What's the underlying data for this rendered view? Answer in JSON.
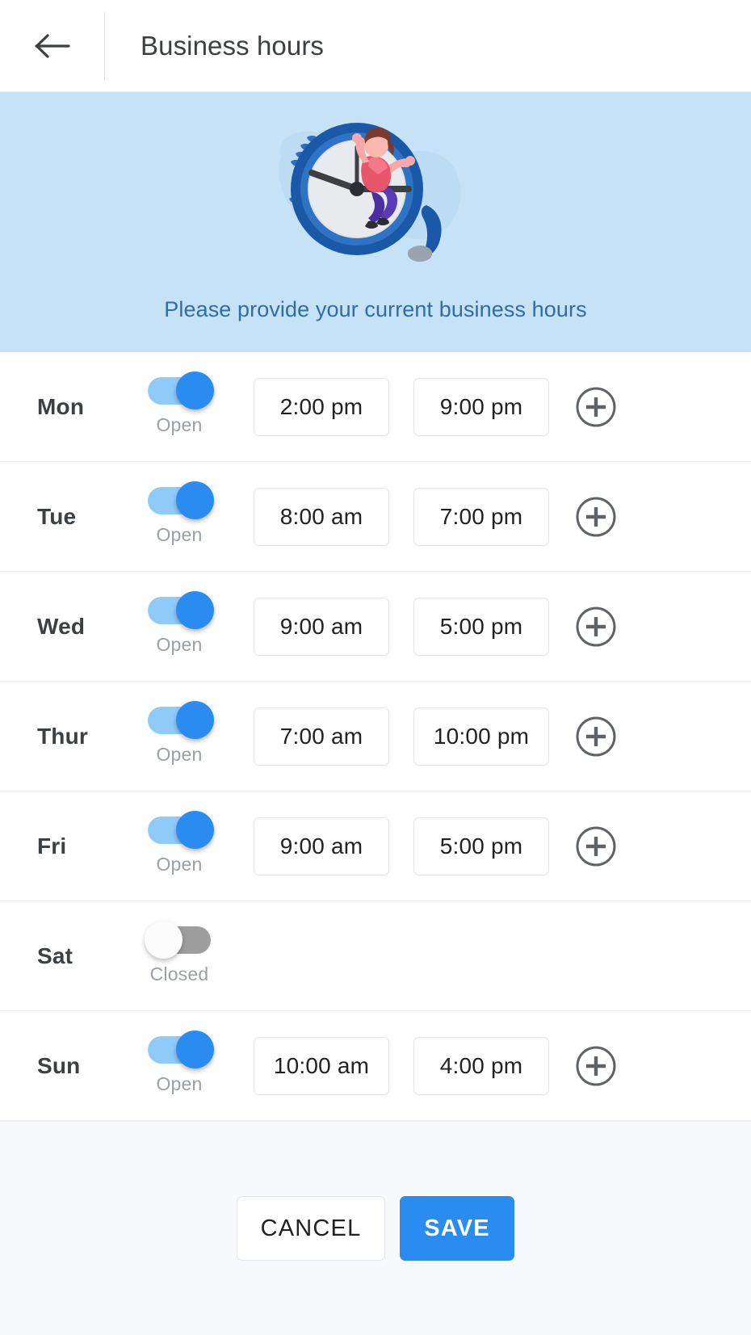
{
  "header": {
    "back_icon": "arrow-left-icon",
    "title": "Business hours"
  },
  "hero": {
    "illustration": "clock-with-woman-illustration",
    "caption": "Please provide your current business hours",
    "background_color": "#c6e2f6",
    "caption_color": "#2f6ca8"
  },
  "schedule": {
    "open_label": "Open",
    "closed_label": "Closed",
    "add_icon": "plus-circle-icon",
    "days": [
      {
        "day": "Mon",
        "open": true,
        "status": "Open",
        "start": "2:00 pm",
        "end": "9:00 pm"
      },
      {
        "day": "Tue",
        "open": true,
        "status": "Open",
        "start": "8:00 am",
        "end": "7:00 pm"
      },
      {
        "day": "Wed",
        "open": true,
        "status": "Open",
        "start": "9:00 am",
        "end": "5:00 pm"
      },
      {
        "day": "Thur",
        "open": true,
        "status": "Open",
        "start": "7:00 am",
        "end": "10:00 pm"
      },
      {
        "day": "Fri",
        "open": true,
        "status": "Open",
        "start": "9:00 am",
        "end": "5:00 pm"
      },
      {
        "day": "Sat",
        "open": false,
        "status": "Closed",
        "start": "",
        "end": ""
      },
      {
        "day": "Sun",
        "open": true,
        "status": "Open",
        "start": "10:00 am",
        "end": "4:00 pm"
      }
    ]
  },
  "footer": {
    "cancel_label": "CANCEL",
    "save_label": "SAVE",
    "save_color": "#2a8cf0",
    "background_color": "#f7f9fc"
  },
  "colors": {
    "toggle_on_track": "#90caf9",
    "toggle_on_knob": "#2a8cf0",
    "toggle_off_track": "#9e9e9e",
    "toggle_off_knob": "#fbfbfb",
    "text_primary": "#3c4043",
    "text_muted": "#9aa0a6"
  }
}
